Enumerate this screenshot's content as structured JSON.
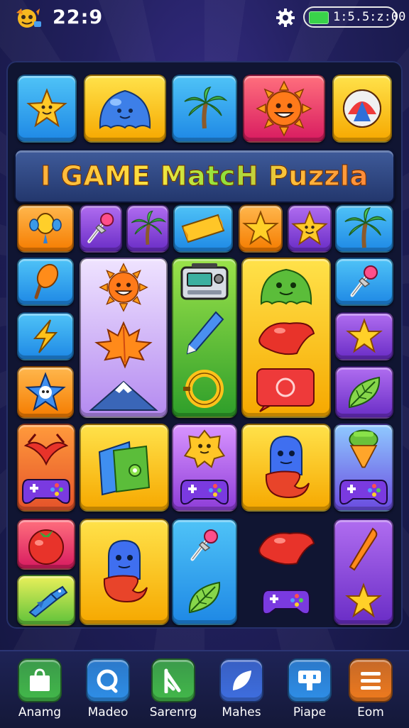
{
  "status": {
    "time": "22:9",
    "battery_text": "1:5.5:z:00"
  },
  "banner": {
    "title": "I GAME MatcH Puzzla"
  },
  "colors": {
    "board": "#101532",
    "banner": "#2f4683",
    "battery": "#39d24a"
  },
  "tiles": [
    {
      "name": "star-face-icon",
      "color": "blue"
    },
    {
      "name": "blue-blob-icon",
      "color": "yellow"
    },
    {
      "name": "palm-tree-icon",
      "color": "blue"
    },
    {
      "name": "sun-face-icon",
      "color": "red"
    },
    {
      "name": "ball-icon",
      "color": "yellow"
    },
    {
      "name": "balloon-icon",
      "color": "orange"
    },
    {
      "name": "pin-icon",
      "color": "purple"
    },
    {
      "name": "palm-tree-icon",
      "color": "purple"
    },
    {
      "name": "cheese-icon",
      "color": "blue"
    },
    {
      "name": "star-icon",
      "color": "orange"
    },
    {
      "name": "star-face-icon",
      "color": "purple"
    },
    {
      "name": "palm-tree-icon",
      "color": "blue"
    },
    {
      "name": "ice-cream-icon",
      "color": "blue"
    },
    {
      "name": "sun-face-icon",
      "color": "lav"
    },
    {
      "name": "maple-leaf-icon",
      "color": "lav"
    },
    {
      "name": "mountain-icon",
      "color": "lav"
    },
    {
      "name": "radio-icon",
      "color": "green"
    },
    {
      "name": "pen-icon",
      "color": "green"
    },
    {
      "name": "ring-icon",
      "color": "green"
    },
    {
      "name": "green-blob-icon",
      "color": "yellow"
    },
    {
      "name": "red-blob-icon",
      "color": "yellow"
    },
    {
      "name": "red-screen-icon",
      "color": "yellow"
    },
    {
      "name": "pin-icon",
      "color": "blue"
    },
    {
      "name": "lightning-icon",
      "color": "blue"
    },
    {
      "name": "star-icon",
      "color": "purple"
    },
    {
      "name": "blue-star-icon",
      "color": "orange"
    },
    {
      "name": "leaf-icon",
      "color": "purple"
    },
    {
      "name": "wings-icon",
      "color": "orangered"
    },
    {
      "name": "gamepad-icon",
      "color": "orangered"
    },
    {
      "name": "book-icon",
      "color": "yellow"
    },
    {
      "name": "yellow-blob-icon",
      "color": "pinkpurple"
    },
    {
      "name": "gamepad-icon",
      "color": "pinkpurple"
    },
    {
      "name": "blue-ghost-icon",
      "color": "yellow"
    },
    {
      "name": "cupcake-icon",
      "color": "bluepurple"
    },
    {
      "name": "gamepad-icon",
      "color": "bluepurple"
    },
    {
      "name": "tomato-icon",
      "color": "red"
    },
    {
      "name": "fish-icon",
      "color": "yelgreen"
    },
    {
      "name": "blue-ghost-icon",
      "color": "yellow"
    },
    {
      "name": "pin-icon",
      "color": "blue"
    },
    {
      "name": "leaf-icon",
      "color": "blue"
    },
    {
      "name": "red-blob-icon",
      "color": "dark"
    },
    {
      "name": "gamepad-icon",
      "color": "dark"
    },
    {
      "name": "carrot-icon",
      "color": "purple"
    },
    {
      "name": "star-icon",
      "color": "purple"
    }
  ],
  "nav": [
    {
      "label": "Anamg",
      "icon": "bag-icon",
      "color": "#43b94a"
    },
    {
      "label": "Madeo",
      "icon": "search-icon",
      "color": "#2f8fe8"
    },
    {
      "label": "Sarenrg",
      "icon": "flag-icon",
      "color": "#43b94a"
    },
    {
      "label": "Mahes",
      "icon": "leaf-icon",
      "color": "#3f6fe0"
    },
    {
      "label": "Piape",
      "icon": "chat-icon",
      "color": "#2f8fe8"
    },
    {
      "label": "Eom",
      "icon": "menu-icon",
      "color": "#f07b1e"
    }
  ]
}
